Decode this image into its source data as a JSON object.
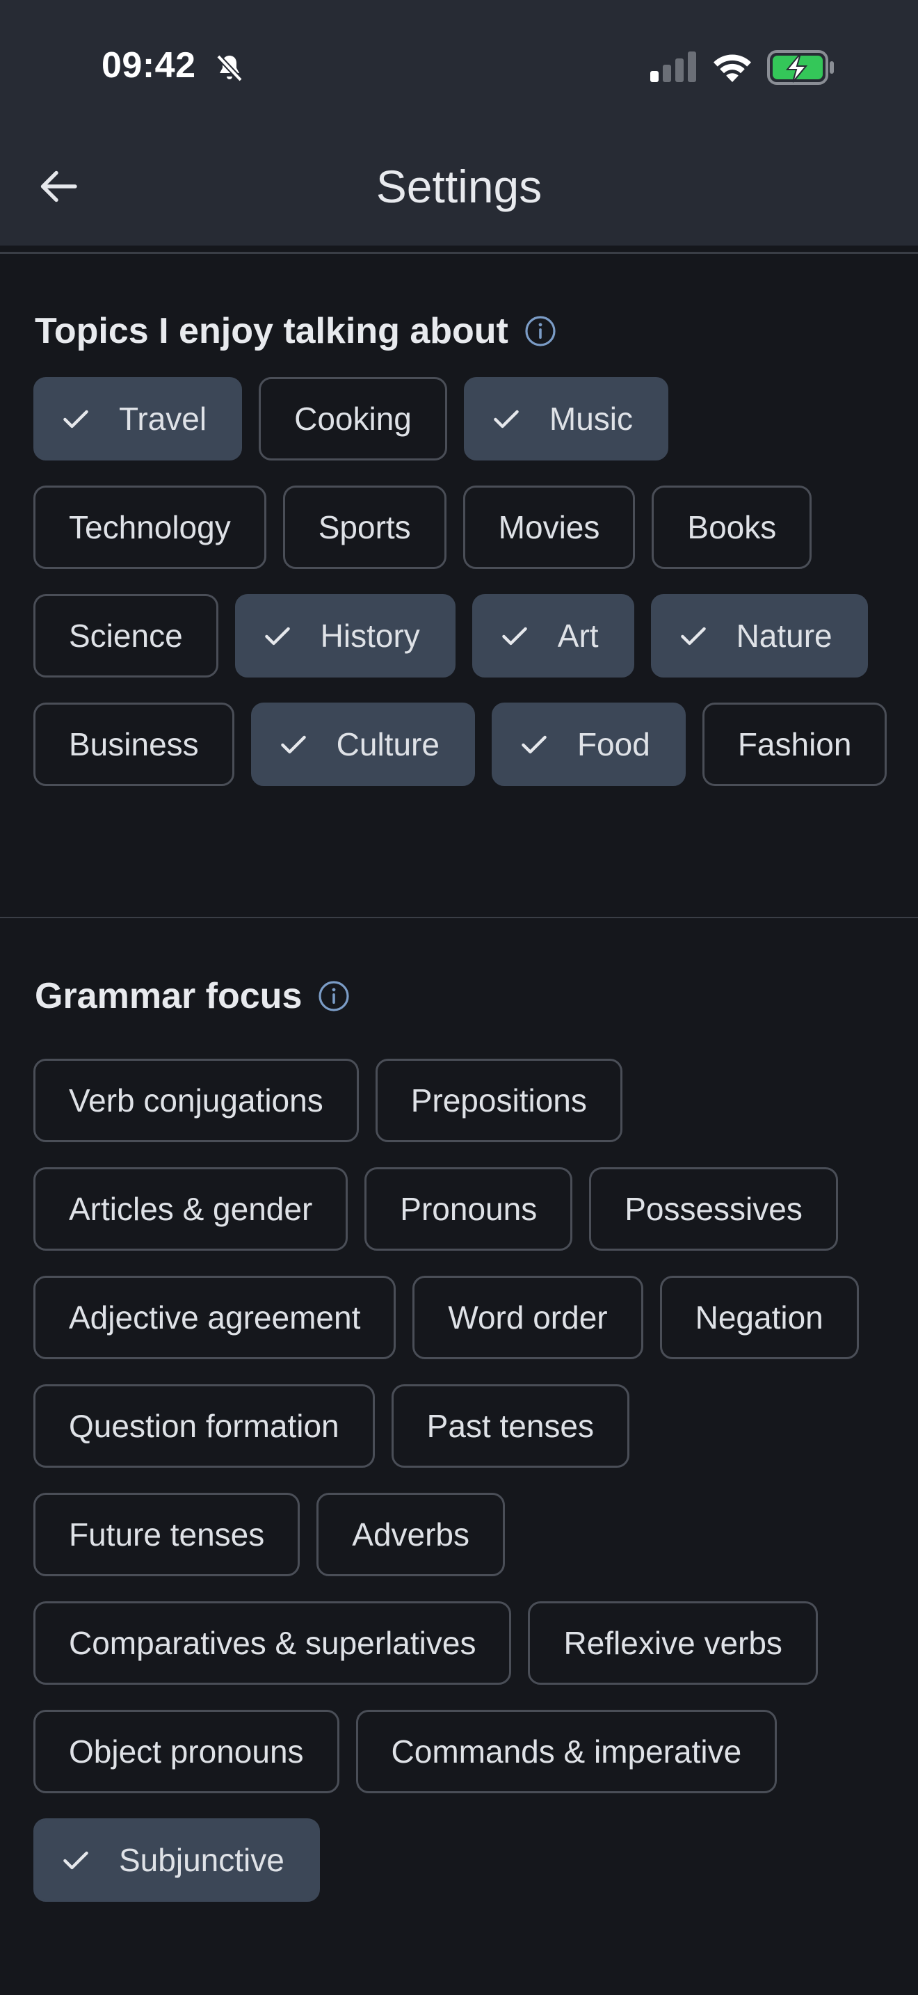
{
  "status_bar": {
    "time": "09:42"
  },
  "header": {
    "title": "Settings"
  },
  "topics": {
    "title": "Topics I enjoy talking about",
    "chips": [
      {
        "label": "Travel",
        "selected": true
      },
      {
        "label": "Cooking",
        "selected": false
      },
      {
        "label": "Music",
        "selected": true
      },
      {
        "label": "Technology",
        "selected": false
      },
      {
        "label": "Sports",
        "selected": false
      },
      {
        "label": "Movies",
        "selected": false
      },
      {
        "label": "Books",
        "selected": false
      },
      {
        "label": "Science",
        "selected": false
      },
      {
        "label": "History",
        "selected": true
      },
      {
        "label": "Art",
        "selected": true
      },
      {
        "label": "Nature",
        "selected": true
      },
      {
        "label": "Business",
        "selected": false
      },
      {
        "label": "Culture",
        "selected": true
      },
      {
        "label": "Food",
        "selected": true
      },
      {
        "label": "Fashion",
        "selected": false
      }
    ]
  },
  "grammar": {
    "title": "Grammar focus",
    "chips": [
      {
        "label": "Verb conjugations",
        "selected": false
      },
      {
        "label": "Prepositions",
        "selected": false
      },
      {
        "label": "Articles & gender",
        "selected": false
      },
      {
        "label": "Pronouns",
        "selected": false
      },
      {
        "label": "Possessives",
        "selected": false
      },
      {
        "label": "Adjective agreement",
        "selected": false
      },
      {
        "label": "Word order",
        "selected": false
      },
      {
        "label": "Negation",
        "selected": false
      },
      {
        "label": "Question formation",
        "selected": false
      },
      {
        "label": "Past tenses",
        "selected": false
      },
      {
        "label": "Future tenses",
        "selected": false
      },
      {
        "label": "Adverbs",
        "selected": false
      },
      {
        "label": "Comparatives & superlatives",
        "selected": false
      },
      {
        "label": "Reflexive verbs",
        "selected": false
      },
      {
        "label": "Object pronouns",
        "selected": false
      },
      {
        "label": "Commands & imperative",
        "selected": false
      },
      {
        "label": "Subjunctive",
        "selected": true
      }
    ]
  },
  "colors": {
    "background": "#15171c",
    "header": "#272b34",
    "chip_selected": "#3c4757",
    "chip_border": "#4a4e57",
    "info_accent": "#7b9cc6",
    "battery_green": "#34c759"
  },
  "icons": {
    "back": "arrow-left",
    "muted": "bell-slash",
    "signal": "cellular-signal",
    "wifi": "wifi",
    "battery": "battery-charging",
    "info": "info-circle",
    "selected": "checkmark"
  }
}
